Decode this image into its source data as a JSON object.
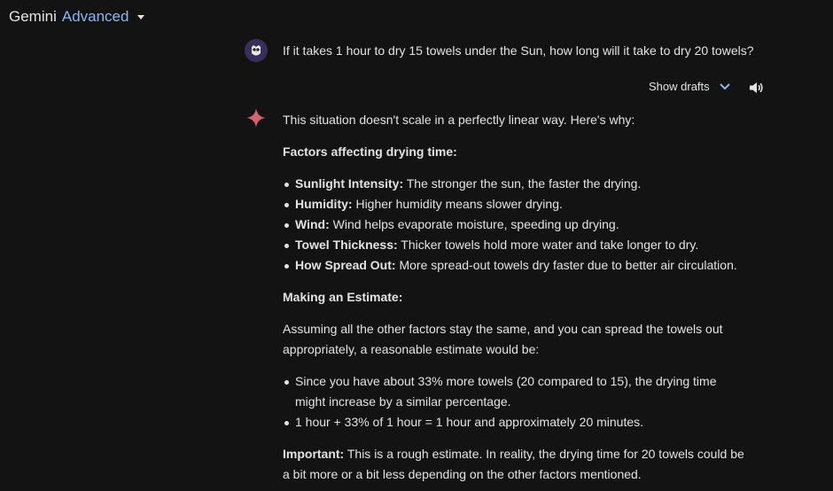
{
  "header": {
    "brand_primary": "Gemini",
    "brand_secondary": "Advanced"
  },
  "user_prompt": {
    "text": "If it takes 1 hour to dry 15 towels under the Sun, how long will it take to dry 20 towels?"
  },
  "response_controls": {
    "show_drafts_label": "Show drafts",
    "chevron_icon": "chevron-down-icon",
    "speaker_icon": "volume-icon"
  },
  "response": {
    "intro": "This situation doesn't scale in a perfectly linear way. Here's why:",
    "factors_heading": "Factors affecting drying time:",
    "factors": [
      {
        "term": "Sunlight Intensity:",
        "text": " The stronger the sun, the faster the drying."
      },
      {
        "term": "Humidity:",
        "text": " Higher humidity means slower drying."
      },
      {
        "term": "Wind:",
        "text": " Wind helps evaporate moisture, speeding up drying."
      },
      {
        "term": "Towel Thickness:",
        "text": " Thicker towels hold more water and take longer to dry."
      },
      {
        "term": "How Spread Out:",
        "text": " More spread-out towels dry faster due to better air circulation."
      }
    ],
    "estimate_heading": "Making an Estimate:",
    "estimate_intro": "Assuming all the other factors stay the same, and you can spread the towels out appropriately, a reasonable estimate would be:",
    "estimate_points": [
      "Since you have about 33% more towels (20 compared to 15), the drying time might increase by a similar percentage.",
      "1 hour + 33% of 1 hour = 1 hour and approximately 20 minutes."
    ],
    "important_label": "Important:",
    "important_text": " This is a rough estimate. In reality, the drying time for 20 towels could be a bit more or a bit less depending on the other factors mentioned."
  },
  "colors": {
    "background": "#131314",
    "text": "#e3e3e3",
    "brand_accent": "#8ab4f8",
    "spark": "#d96570"
  }
}
